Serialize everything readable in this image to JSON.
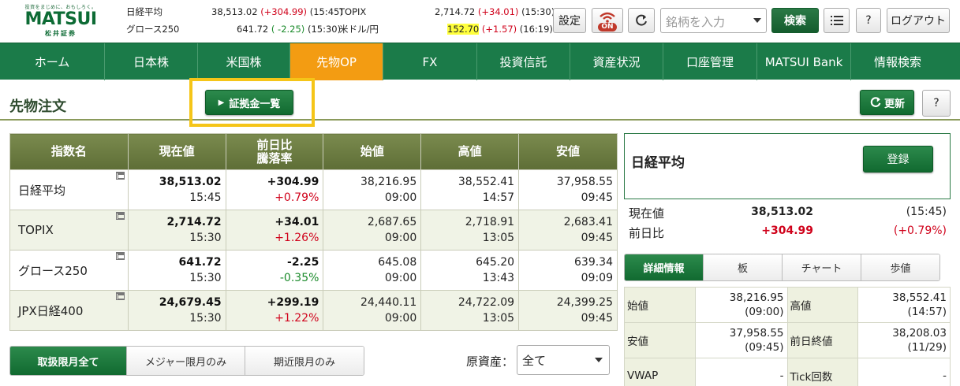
{
  "brand": {
    "tagline": "投資をまじめに、おもしろく。",
    "name": "MATSUI",
    "sub": "松井証券"
  },
  "tickers": [
    {
      "name": "日経平均",
      "value": "38,513.02",
      "change": "(+304.99)",
      "dir": "up",
      "time": "(15:45)"
    },
    {
      "name": "グロース250",
      "value": "641.72",
      "change": "( -2.25)",
      "dir": "down",
      "time": "(15:30)"
    },
    {
      "name": "TOPIX",
      "value": "2,714.72",
      "change": "(+34.01)",
      "dir": "up",
      "time": "(15:30)"
    },
    {
      "name": "米ドル/円",
      "value": "152.70",
      "change": "(+1.57)",
      "dir": "up",
      "time": "(16:19)"
    }
  ],
  "toolbar": {
    "settings": "設定",
    "on_badge": "ON",
    "search_placeholder": "銘柄を入力",
    "search_button": "検索",
    "help": "?",
    "logout": "ログアウト"
  },
  "nav": [
    {
      "label": "ホーム"
    },
    {
      "label": "日本株"
    },
    {
      "label": "米国株"
    },
    {
      "label": "先物OP",
      "active": true
    },
    {
      "label": "FX"
    },
    {
      "label": "投資信託"
    },
    {
      "label": "資産状況"
    },
    {
      "label": "口座管理"
    },
    {
      "label": "MATSUI Bank"
    },
    {
      "label": "情報検索"
    }
  ],
  "page": {
    "title": "先物注文",
    "margin_list_button": "証拠金一覧",
    "refresh_button": "更新",
    "help_button": "?"
  },
  "index_table": {
    "headers": [
      "指数名",
      "現在値",
      "前日比\n騰落率",
      "始値",
      "高値",
      "安値"
    ],
    "rows": [
      {
        "name": "日経平均",
        "price": "38,513.02",
        "price_time": "15:45",
        "change": "+304.99",
        "change_pct": "+0.79%",
        "dir": "up",
        "open": "38,216.95",
        "open_time": "09:00",
        "high": "38,552.41",
        "high_time": "14:57",
        "low": "37,958.55",
        "low_time": "09:45"
      },
      {
        "name": "TOPIX",
        "price": "2,714.72",
        "price_time": "15:30",
        "change": "+34.01",
        "change_pct": "+1.26%",
        "dir": "up",
        "open": "2,687.65",
        "open_time": "09:00",
        "high": "2,718.91",
        "high_time": "13:05",
        "low": "2,683.41",
        "low_time": "09:45"
      },
      {
        "name": "グロース250",
        "price": "641.72",
        "price_time": "15:30",
        "change": "-2.25",
        "change_pct": "-0.35%",
        "dir": "down",
        "open": "645.08",
        "open_time": "09:00",
        "high": "645.20",
        "high_time": "13:43",
        "low": "639.34",
        "low_time": "09:09"
      },
      {
        "name": "JPX日経400",
        "price": "24,679.45",
        "price_time": "15:30",
        "change": "+299.19",
        "change_pct": "+1.22%",
        "dir": "up",
        "open": "24,440.11",
        "open_time": "09:00",
        "high": "24,722.09",
        "high_time": "13:05",
        "low": "24,399.25",
        "low_time": "09:45"
      }
    ]
  },
  "limit_tabs": [
    "取扱限月全て",
    "メジャー限月のみ",
    "期近限月のみ"
  ],
  "underlying": {
    "label": "原資産：",
    "selected": "全て"
  },
  "detail": {
    "name": "日経平均",
    "register_button": "登録",
    "current_label": "現在値",
    "current_value": "38,513.02",
    "current_time": "(15:45)",
    "change_label": "前日比",
    "change_value": "+304.99",
    "change_pct": "(+0.79%)",
    "tabs": [
      "詳細情報",
      "板",
      "チャート",
      "歩値"
    ],
    "rows": [
      [
        {
          "k": "始値",
          "v1": "38,216.95",
          "v2": "(09:00)"
        },
        {
          "k": "高値",
          "v1": "38,552.41",
          "v2": "(14:57)"
        }
      ],
      [
        {
          "k": "安値",
          "v1": "37,958.55",
          "v2": "(09:45)"
        },
        {
          "k": "前日終値",
          "v1": "38,208.03",
          "v2": "(11/29)"
        }
      ],
      [
        {
          "k": "VWAP",
          "v1": "-",
          "v2": ""
        },
        {
          "k": "Tick回数",
          "v1": "-",
          "v2": ""
        }
      ]
    ]
  },
  "colors": {
    "brand_green": "#1b7b49",
    "active_tab": "#f39c12",
    "up": "#d0021b",
    "down": "#1a8a2a",
    "highlight": "#f5c518"
  }
}
